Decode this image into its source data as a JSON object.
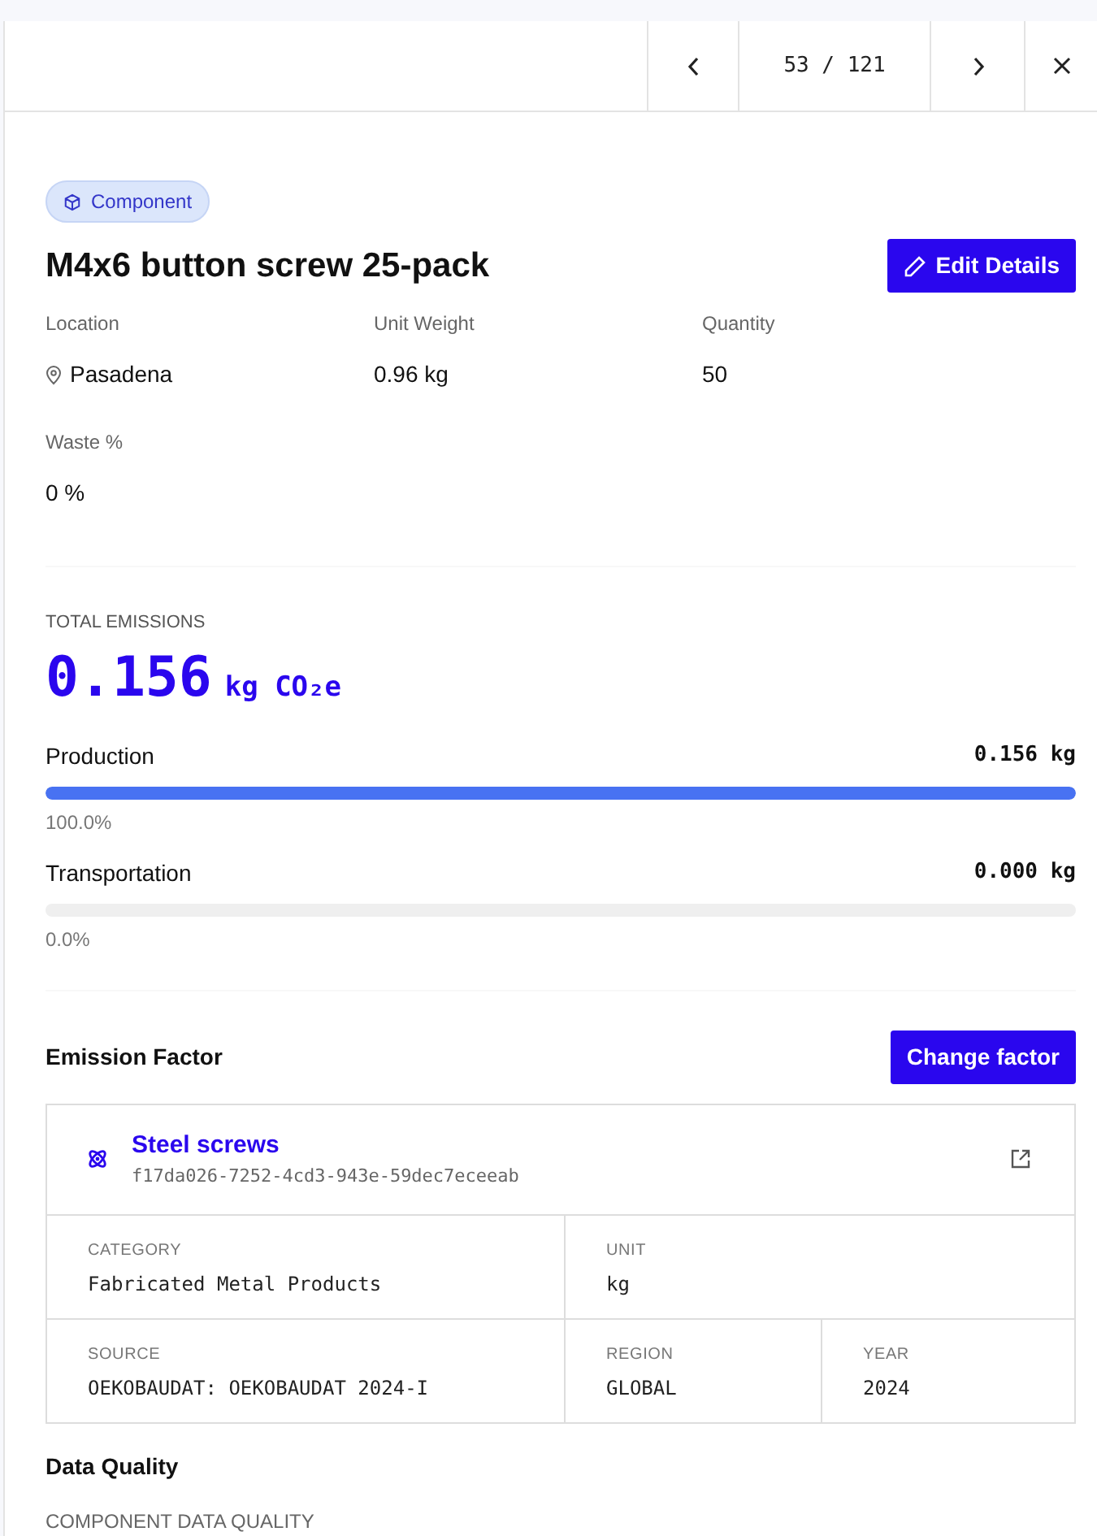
{
  "pager": {
    "counter": "53 / 121"
  },
  "item": {
    "badge": "Component",
    "title": "M4x6 button screw 25-pack",
    "edit_button": "Edit Details"
  },
  "fields": [
    {
      "kind": "location",
      "label": "Location",
      "value": "Pasadena"
    },
    {
      "kind": "plain",
      "label": "Unit Weight",
      "value": "0.96 kg"
    },
    {
      "kind": "plain",
      "label": "Quantity",
      "value": "50"
    },
    {
      "kind": "plain",
      "label": "Waste %",
      "value": "0 %"
    }
  ],
  "emissions": {
    "label": "TOTAL EMISSIONS",
    "value": "0.156",
    "unit": "kg CO₂e",
    "breakdown": [
      {
        "name": "Production",
        "amount": "0.156 kg",
        "level": 1.0,
        "percent": "100.0%"
      },
      {
        "name": "Transportation",
        "amount": "0.000 kg",
        "level": 0.0,
        "percent": "0.0%"
      }
    ]
  },
  "emission_factor": {
    "heading": "Emission Factor",
    "change_button": "Change factor",
    "name": "Steel screws",
    "id": "f17da026-7252-4cd3-943e-59dec7eceeab",
    "rows": [
      [
        {
          "label": "CATEGORY",
          "value": "Fabricated Metal Products"
        },
        {
          "label": "UNIT",
          "value": "kg"
        }
      ],
      [
        {
          "label": "SOURCE",
          "value": "OEKOBAUDAT: OEKOBAUDAT 2024-I"
        },
        {
          "label": "REGION",
          "value": "GLOBAL"
        },
        {
          "label": "YEAR",
          "value": "2024"
        }
      ]
    ]
  },
  "data_quality": {
    "heading": "Data Quality",
    "subtitle": "COMPONENT DATA QUALITY"
  }
}
